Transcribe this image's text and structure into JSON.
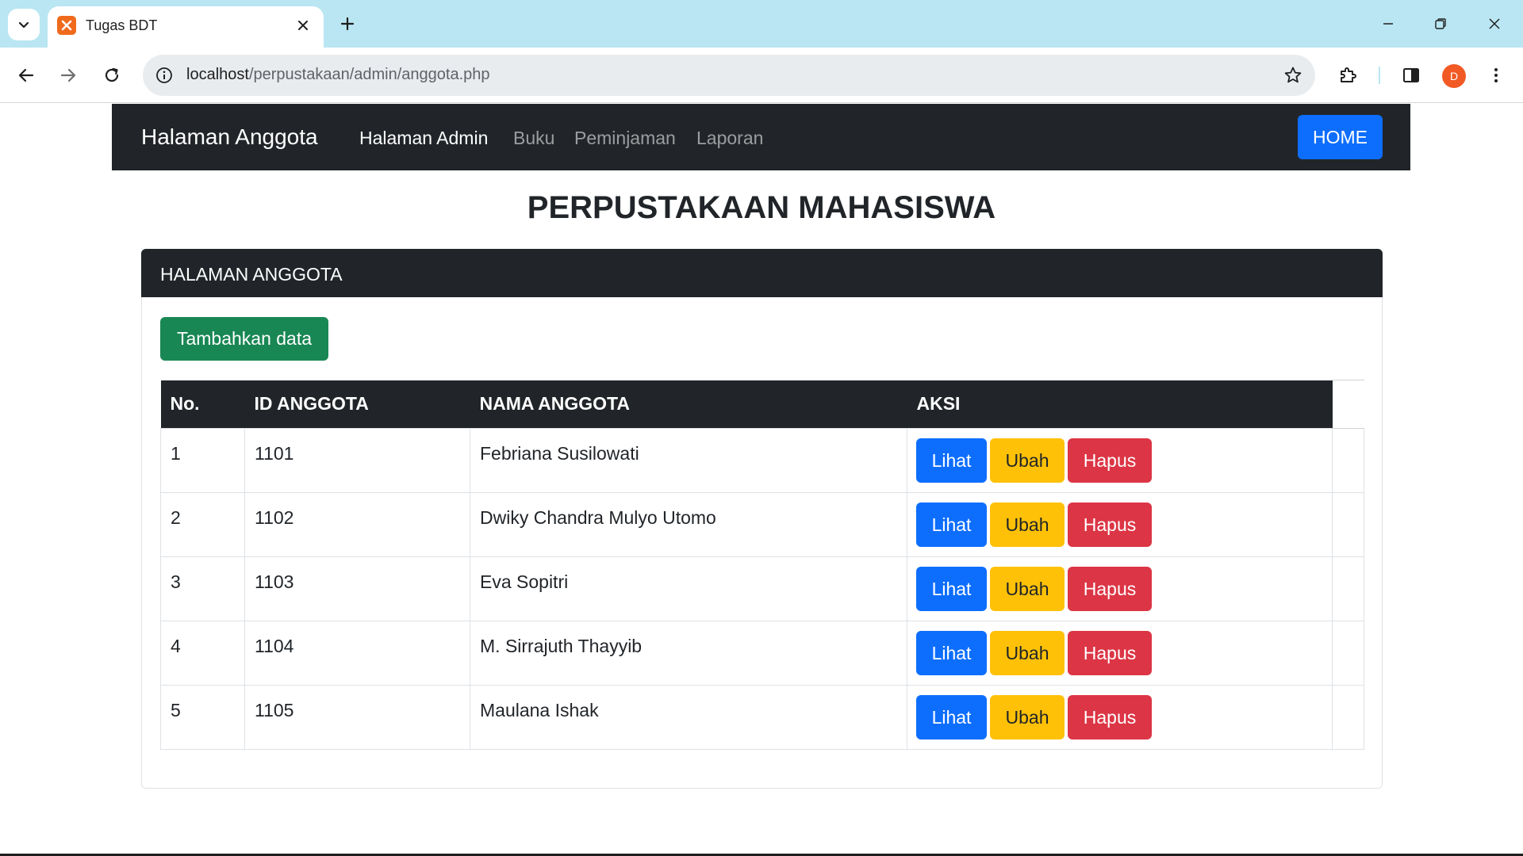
{
  "browser": {
    "tab_title": "Tugas BDT",
    "url_host": "localhost",
    "url_path": "/perpustakaan/admin/anggota.php",
    "profile_initial": "D"
  },
  "navbar": {
    "brand": "Halaman Anggota",
    "links": [
      {
        "label": "Halaman Admin",
        "active": true
      },
      {
        "label": "Buku",
        "active": false
      },
      {
        "label": "Peminjaman",
        "active": false
      },
      {
        "label": "Laporan",
        "active": false
      }
    ],
    "home_label": "HOME"
  },
  "page_title": "PERPUSTAKAAN MAHASISWA",
  "card": {
    "header": "HALAMAN ANGGOTA",
    "add_button": "Tambahkan data"
  },
  "table": {
    "headers": [
      "No.",
      "ID ANGGOTA",
      "NAMA ANGGOTA",
      "AKSI"
    ],
    "rows": [
      {
        "no": "1",
        "id": "1101",
        "nama": "Febriana Susilowati"
      },
      {
        "no": "2",
        "id": "1102",
        "nama": "Dwiky Chandra Mulyo Utomo"
      },
      {
        "no": "3",
        "id": "1103",
        "nama": "Eva Sopitri"
      },
      {
        "no": "4",
        "id": "1104",
        "nama": "M. Sirrajuth Thayyib"
      },
      {
        "no": "5",
        "id": "1105",
        "nama": "Maulana Ishak"
      }
    ],
    "actions": {
      "view": "Lihat",
      "edit": "Ubah",
      "delete": "Hapus"
    }
  },
  "colors": {
    "navbar": "#212529",
    "primary": "#0d6efd",
    "success": "#198754",
    "warning": "#ffc107",
    "danger": "#dc3545",
    "tabbar": "#b9e6f2"
  }
}
